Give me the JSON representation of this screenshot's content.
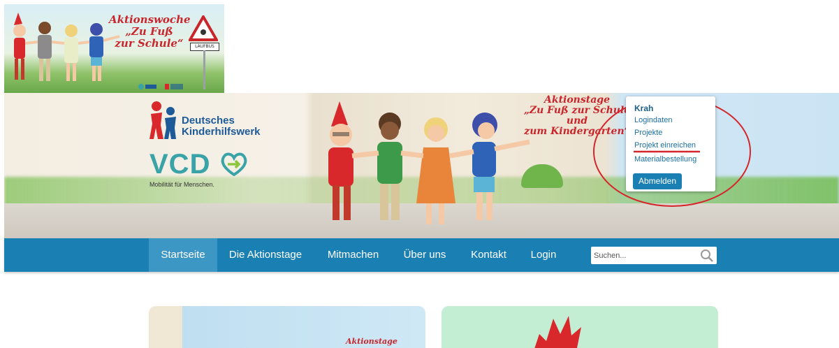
{
  "small_banner": {
    "title_lines": [
      "Aktionswoche",
      "„Zu Fuß",
      "zur Schule“"
    ],
    "sign_label": "LAUFBUS",
    "icon": "children-walking-illustration"
  },
  "hero": {
    "dkhw_logo_lines": [
      "Deutsches",
      "Kinderhilfswerk"
    ],
    "vcd_logo": "VCD",
    "vcd_tagline": "Mobilität für Menschen.",
    "title_lines": [
      "Aktionstage",
      "„Zu Fuß zur Schule und",
      "zum Kindergarten“"
    ]
  },
  "user_menu": {
    "username": "Krah",
    "items": [
      "Logindaten",
      "Projekte",
      "Projekt einreichen",
      "Materialbestellung"
    ],
    "highlighted_item": "Projekt einreichen",
    "logout_label": "Abmelden"
  },
  "nav": {
    "items": [
      "Startseite",
      "Die Aktionstage",
      "Mitmachen",
      "Über uns",
      "Kontakt",
      "Login"
    ],
    "active_item": "Startseite",
    "search_placeholder": "Suchen..."
  },
  "cards": {
    "left_title": "Aktionstage"
  },
  "colors": {
    "nav_bg": "#1a7fb3",
    "nav_active": "#3d97c4",
    "accent_red": "#c8262b",
    "link_blue": "#1a6fa1"
  }
}
